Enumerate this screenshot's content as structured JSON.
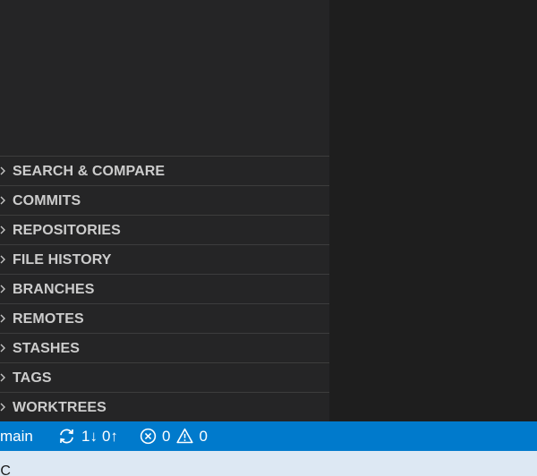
{
  "sidebar": {
    "sections": [
      {
        "label": "SEARCH & COMPARE"
      },
      {
        "label": "COMMITS"
      },
      {
        "label": "REPOSITORIES"
      },
      {
        "label": "FILE HISTORY"
      },
      {
        "label": "BRANCHES"
      },
      {
        "label": "REMOTES"
      },
      {
        "label": "STASHES"
      },
      {
        "label": "TAGS"
      },
      {
        "label": "WORKTREES"
      }
    ]
  },
  "statusbar": {
    "branch": "main",
    "sync_incoming": "1↓",
    "sync_outgoing": "0↑",
    "errors": "0",
    "warnings": "0",
    "background": "#007acc"
  },
  "taskbar": {
    "temperature": "°C"
  },
  "icons": {
    "section_chevron": "chevron-right-icon",
    "sync": "sync-icon",
    "errors": "error-circle-icon",
    "warnings": "warning-triangle-icon"
  }
}
